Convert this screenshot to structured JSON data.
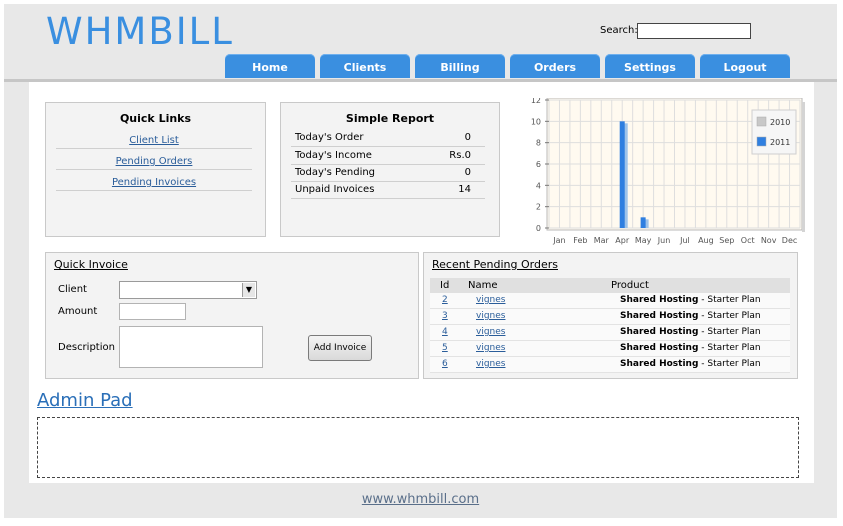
{
  "app": {
    "logo_text": "WHMBILL"
  },
  "search": {
    "label": "Search:",
    "value": ""
  },
  "nav": {
    "tabs": [
      "Home",
      "Clients",
      "Billing",
      "Orders",
      "Settings",
      "Logout"
    ]
  },
  "quick_links": {
    "title": "Quick Links",
    "items": [
      "Client List",
      "Pending Orders",
      "Pending Invoices"
    ]
  },
  "simple_report": {
    "title": "Simple Report",
    "rows": [
      {
        "label": "Today's Order",
        "value": "0"
      },
      {
        "label": "Today's Income",
        "value": "Rs.0"
      },
      {
        "label": "Today's Pending",
        "value": "0"
      },
      {
        "label": "Unpaid Invoices",
        "value": "14"
      }
    ]
  },
  "chart_data": {
    "type": "bar",
    "categories": [
      "Jan",
      "Feb",
      "Mar",
      "Apr",
      "May",
      "Jun",
      "Jul",
      "Aug",
      "Sep",
      "Oct",
      "Nov",
      "Dec"
    ],
    "series": [
      {
        "name": "2010",
        "values": [
          0,
          0,
          0,
          0,
          0,
          0,
          0,
          0,
          0,
          0,
          0,
          0
        ],
        "color": "#c8c8c8"
      },
      {
        "name": "2011",
        "values": [
          0,
          0,
          0,
          10,
          1,
          0,
          0,
          0,
          0,
          0,
          0,
          0
        ],
        "color": "#2f7fe0"
      }
    ],
    "yticks": [
      "0",
      "2",
      "4",
      "6",
      "8",
      "10",
      "12"
    ],
    "ylim": [
      0,
      12
    ],
    "grid": true,
    "legend": "top-right"
  },
  "quick_invoice": {
    "title": "Quick Invoice",
    "client_label": "Client",
    "client_value": "",
    "amount_label": "Amount",
    "amount_value": "",
    "description_label": "Description",
    "description_value": "",
    "submit_label": "Add Invoice"
  },
  "recent_orders": {
    "title": "Recent Pending Orders",
    "headers": [
      "Id",
      "Name",
      "Product"
    ],
    "rows": [
      {
        "id": "2",
        "name": "vignes",
        "product_bold": "Shared Hosting",
        "product_rest": " - Starter Plan"
      },
      {
        "id": "3",
        "name": "vignes",
        "product_bold": "Shared Hosting",
        "product_rest": " - Starter Plan"
      },
      {
        "id": "4",
        "name": "vignes",
        "product_bold": "Shared Hosting",
        "product_rest": " - Starter Plan"
      },
      {
        "id": "5",
        "name": "vignes",
        "product_bold": "Shared Hosting",
        "product_rest": " - Starter Plan"
      },
      {
        "id": "6",
        "name": "vignes",
        "product_bold": "Shared Hosting",
        "product_rest": " - Starter Plan"
      }
    ]
  },
  "admin_pad": {
    "title": "Admin Pad",
    "value": ""
  },
  "footer": {
    "link": "www.whmbill.com"
  }
}
